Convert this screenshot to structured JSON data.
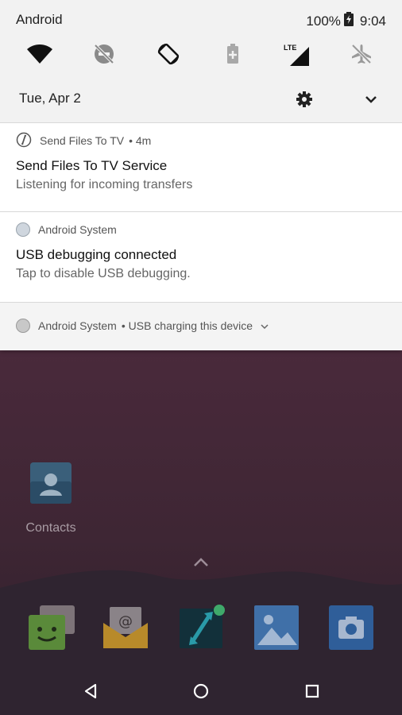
{
  "status_bar": {
    "carrier": "Android",
    "battery": "100%",
    "time": "9:04"
  },
  "quick_settings": {
    "date": "Tue, Apr 2",
    "lte_label": "LTE"
  },
  "notifications": [
    {
      "app": "Send Files To TV",
      "meta": "• 4m",
      "title": "Send Files To TV Service",
      "text": "Listening for incoming transfers"
    },
    {
      "app": "Android System",
      "meta": "",
      "title": "USB debugging connected",
      "text": "Tap to disable USB debugging."
    }
  ],
  "collapsed_notification": {
    "app": "Android System",
    "text": "• USB charging this device"
  },
  "home": {
    "contacts_label": "Contacts"
  },
  "colors": {
    "accent_green": "#3fa96a",
    "shade_bg": "#f2f2f2",
    "wallpaper_top": "#5a2e43"
  }
}
